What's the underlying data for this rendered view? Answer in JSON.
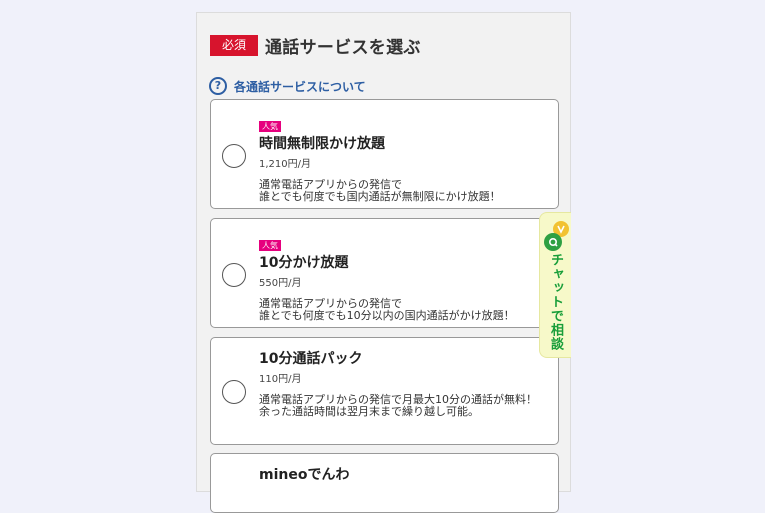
{
  "section": {
    "required_label": "必須",
    "title": "通話サービスを選ぶ"
  },
  "help": {
    "icon": "question-circle-icon",
    "label": "各通話サービスについて"
  },
  "options": [
    {
      "badge": "人気",
      "title": "時間無制限かけ放題",
      "price": "1,210円/月",
      "description": "通常電話アプリからの発信で\n誰とでも何度でも国内通話が無制限にかけ放題！"
    },
    {
      "badge": "人気",
      "title": "10分かけ放題",
      "price": "550円/月",
      "description": "通常電話アプリからの発信で\n誰とでも何度でも10分以内の国内通話がかけ放題！"
    },
    {
      "badge": "",
      "title": "10分通話パック",
      "price": "110円/月",
      "description": "通常電話アプリからの発信で月最大10分の通話が無料！\n余った通話時間は翌月末まで繰り越し可能。"
    },
    {
      "badge": "",
      "title": "mineoでんわ",
      "price": "",
      "description": ""
    }
  ],
  "chat": {
    "label": "チャットで相談",
    "icon": "chat-bubbles-icon",
    "colors": {
      "background": "#f7f9c9",
      "text": "#199e3a",
      "bubble_green": "#2ea043",
      "bubble_yellow": "#f2c232"
    }
  },
  "colors": {
    "required_badge": "#d7142d",
    "popular_badge": "#e6007e",
    "link": "#2d5ea3"
  }
}
